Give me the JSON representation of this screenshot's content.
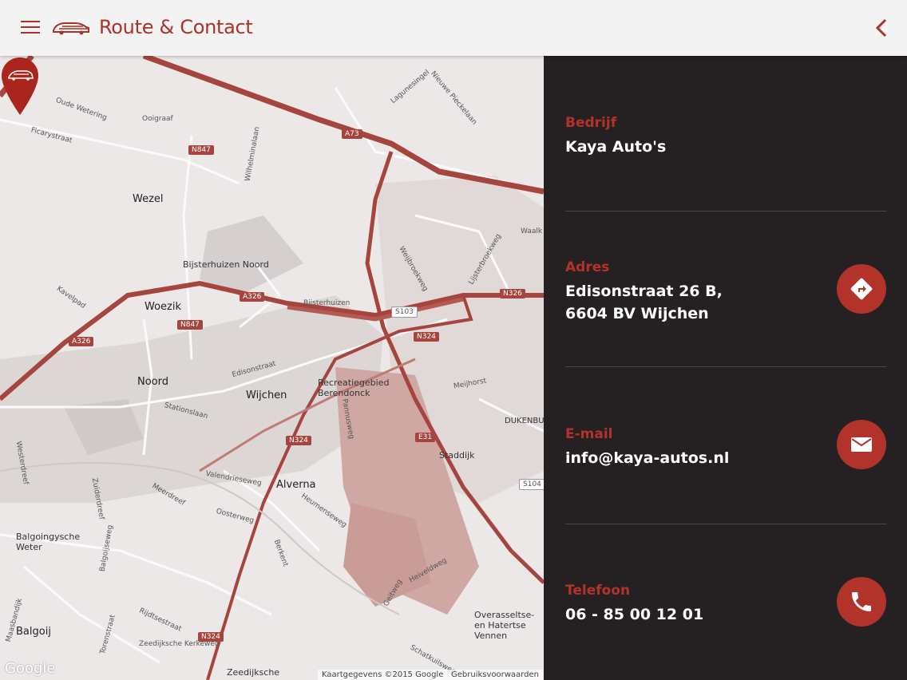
{
  "header": {
    "title": "Route & Contact"
  },
  "map": {
    "places": [
      "Wezel",
      "Woezik",
      "Noord",
      "Wijchen",
      "Alverna",
      "Balgoij",
      "Bijsterhuizen Noord",
      "Recreatiegebied Berendonck",
      "Balgoingysche Weter",
      "Overasseltse- en Hatertse Vennen",
      "DUKENBU",
      "Staddijk",
      "Zeedijksche"
    ],
    "streets": [
      "Oude Wetering",
      "Ficarystraat",
      "Ooigraaf",
      "Edisonstraat",
      "Stationslaan",
      "Kavelpad",
      "Meerdreef",
      "Valendrieseweg",
      "Oosterweg",
      "Heumenseweg",
      "Bijsterhuizen",
      "Lagunesingel",
      "Nieuwe Pieckelaan",
      "Weijbroekweg",
      "Lijsterbroekweg",
      "Meijhorst",
      "Pannusweg",
      "Berkent",
      "Zuiderdreef",
      "Westerdreef",
      "Torenstraat",
      "Rijdtsestraat",
      "Heiveldweg",
      "Geitweg",
      "Schatkuilsweg",
      "Wilhelminalaan",
      "Maasbandijk",
      "Balgoijseweg",
      "Zeedijksche Kerkeweg",
      "Waalk..."
    ],
    "shields": [
      "N847",
      "A73",
      "A326",
      "N847",
      "A326",
      "S103",
      "N324",
      "N326",
      "N324",
      "E31",
      "S104",
      "N324"
    ],
    "google_logo": "Google",
    "attribution": "Kaartgegevens ©2015 Google",
    "terms": "Gebruiksvoorwaarden"
  },
  "contact": {
    "company": {
      "label": "Bedrijf",
      "value": "Kaya Auto's"
    },
    "address": {
      "label": "Adres",
      "line1": "Edisonstraat 26 B,",
      "line2": "6604 BV Wijchen"
    },
    "email": {
      "label": "E-mail",
      "value": "info@kaya-autos.nl"
    },
    "phone": {
      "label": "Telefoon",
      "value": "06 - 85 00 12 01"
    }
  },
  "colors": {
    "accent": "#b2332a",
    "panel": "#252123",
    "appbar": "#f4f3f3",
    "road": "#a5453d"
  }
}
